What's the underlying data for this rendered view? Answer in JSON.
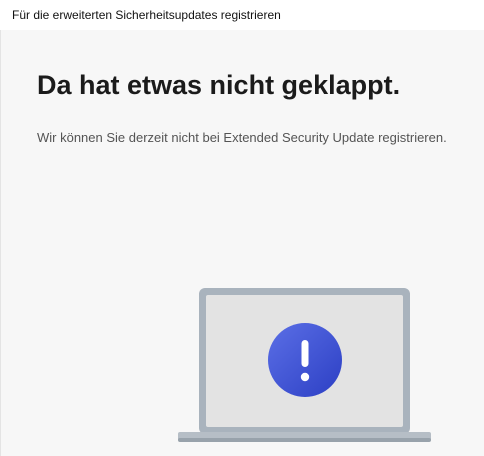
{
  "window": {
    "title": "Für die erweiterten Sicherheitsupdates registrieren"
  },
  "main": {
    "heading": "Da hat etwas nicht geklappt.",
    "message": "Wir können Sie derzeit nicht bei Extended Security Update registrieren."
  },
  "illustration": {
    "device": "laptop-icon",
    "symbol": "exclamation-icon",
    "badge_color": "#3a51d6",
    "frame_color": "#a9b3bd",
    "screen_color": "#e3e3e3"
  }
}
